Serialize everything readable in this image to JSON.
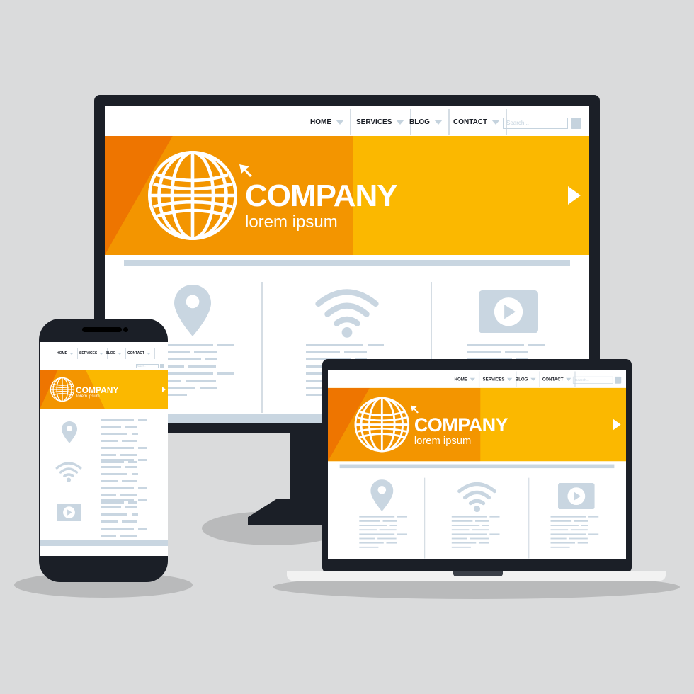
{
  "site": {
    "nav": [
      {
        "label": "HOME"
      },
      {
        "label": "SERVICES"
      },
      {
        "label": "BLOG"
      },
      {
        "label": "CONTACT"
      }
    ],
    "search_placeholder": "Search...",
    "company": "COMPANY",
    "tagline": "lorem ipsum"
  },
  "icons": [
    "globe-icon",
    "cursor-arrow-icon",
    "next-arrow-icon",
    "location-pin-icon",
    "wifi-icon",
    "video-play-icon",
    "search-icon"
  ],
  "colors": {
    "frame": "#1b1f27",
    "banner": "#fbb800",
    "banner_mid": "#f39500",
    "banner_dark": "#ee7500",
    "placeholder": "#c9d6e1",
    "background": "#dadbdc"
  }
}
